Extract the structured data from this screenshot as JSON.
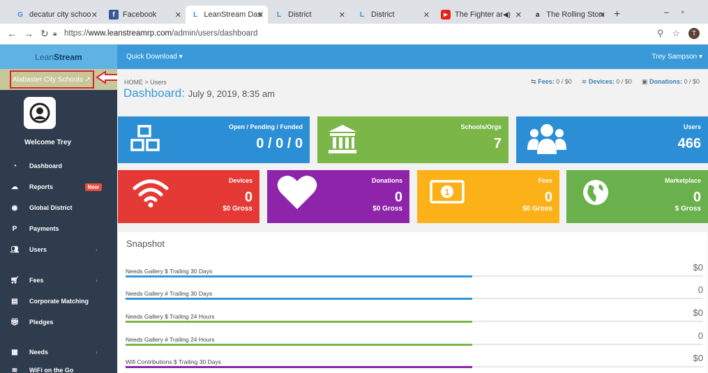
{
  "browser": {
    "tabs": [
      {
        "title": "decatur city schoo",
        "icon": "google-icon"
      },
      {
        "title": "Facebook",
        "icon": "facebook-icon"
      },
      {
        "title": "LeanStream Dashb",
        "icon": "leanstream-icon"
      },
      {
        "title": "District",
        "icon": "leanstream-icon"
      },
      {
        "title": "District",
        "icon": "leanstream-icon"
      },
      {
        "title": "The Fighter ar",
        "icon": "youtube-icon"
      },
      {
        "title": "The Rolling Stone",
        "icon": "amazon-icon"
      }
    ],
    "new_tab": "+",
    "url_prefix": "https://",
    "url_host": "www.leanstreamrp.com",
    "url_path": "/admin/users/dashboard",
    "profile_initial": "T"
  },
  "header": {
    "brand_light": "Lean",
    "brand_bold": "Stream",
    "quick_download": "Quick Download ▾",
    "user": "Trey Sampson ▾"
  },
  "sidebar": {
    "school": "Alabaster City Schools",
    "welcome": "Welcome Trey",
    "items": [
      {
        "label": "Dashboard",
        "icon": "dashboard-icon"
      },
      {
        "label": "Reports",
        "icon": "cloud-icon",
        "badge": "New"
      },
      {
        "label": "Global District",
        "icon": "eye-icon"
      },
      {
        "label": "Payments",
        "icon": "paypal-icon"
      },
      {
        "label": "Users",
        "icon": "users-icon"
      },
      {
        "label": "Fees",
        "icon": "cart-icon"
      },
      {
        "label": "Corporate Matching",
        "icon": "document-icon"
      },
      {
        "label": "Pledges",
        "icon": "gift-icon"
      },
      {
        "label": "Needs",
        "icon": "table-icon"
      },
      {
        "label": "WiFi on the Go",
        "icon": "wifi-icon"
      }
    ]
  },
  "main": {
    "breadcrumb": "HOME  >  Users",
    "title": "Dashboard:",
    "date": "July 9, 2019, 8:35 am",
    "stats": [
      {
        "label": "Fees:",
        "value": "0 / $0"
      },
      {
        "label": "Devices:",
        "value": "0 / $0"
      },
      {
        "label": "Donations:",
        "value": "0 / $0"
      }
    ],
    "tiles": [
      {
        "label": "Open / Pending / Funded",
        "value": "0 / 0 / 0",
        "color": "#2c8fd6",
        "icon": "cubes-icon"
      },
      {
        "label": "Schools/Orgs",
        "value": "7",
        "color": "#7ab648",
        "icon": "building-icon"
      },
      {
        "label": "Users",
        "value": "466",
        "color": "#2c8fd6",
        "icon": "users-icon"
      },
      {
        "label": "Devices",
        "value": "0",
        "gross": "$0 Gross",
        "color": "#e53935",
        "icon": "wifi-icon"
      },
      {
        "label": "Donations",
        "value": "0",
        "gross": "$0 Gross",
        "color": "#8e24aa",
        "icon": "heart-icon"
      },
      {
        "label": "Fees",
        "value": "0",
        "gross": "$0 Gross",
        "color": "#fbb117",
        "icon": "money-icon"
      },
      {
        "label": "Marketplace",
        "value": "0",
        "gross": "$ Gross",
        "color": "#6ab04c",
        "icon": "globe-icon"
      }
    ],
    "snapshot": {
      "title": "Snapshot",
      "rows": [
        {
          "label": "Needs Gallery $ Trailing 30 Days",
          "value": "$0",
          "color": "#2c9ad9",
          "fill": 0.6
        },
        {
          "label": "Needs Gallery # Trailing 30 Days",
          "value": "0",
          "color": "#2c9ad9",
          "fill": 0.6
        },
        {
          "label": "Needs Gallery $ Trailing 24 Hours",
          "value": "$0",
          "color": "#7ab648",
          "fill": 0.6
        },
        {
          "label": "Needs Gallery # Trailing 24 Hours",
          "value": "0",
          "color": "#7ab648",
          "fill": 0.6
        },
        {
          "label": "Wifi Contributions $ Trailing 30 Days",
          "value": "$0",
          "color": "#8e24aa",
          "fill": 0.6
        }
      ]
    }
  }
}
